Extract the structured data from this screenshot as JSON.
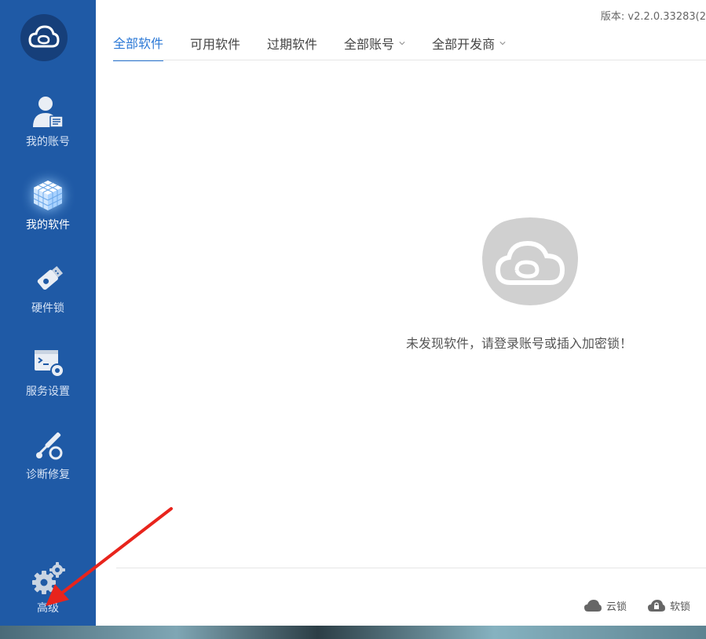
{
  "app": {
    "version": "版本: v2.2.0.33283(2"
  },
  "sidebar": {
    "items": [
      {
        "label": "我的账号",
        "icon": "user-account-icon"
      },
      {
        "label": "我的软件",
        "icon": "software-cube-icon",
        "active": true
      },
      {
        "label": "硬件锁",
        "icon": "usb-dongle-icon"
      },
      {
        "label": "服务设置",
        "icon": "service-terminal-gear-icon"
      },
      {
        "label": "诊断修复",
        "icon": "diagnose-wrench-icon"
      },
      {
        "label": "高级",
        "icon": "gears-icon"
      }
    ]
  },
  "tabs": [
    {
      "label": "全部软件",
      "active": true
    },
    {
      "label": "可用软件"
    },
    {
      "label": "过期软件"
    },
    {
      "label": "全部账号",
      "dropdown": true
    },
    {
      "label": "全部开发商",
      "dropdown": true
    }
  ],
  "main": {
    "empty_message": "未发现软件，请登录账号或插入加密锁！"
  },
  "statusbar": {
    "cloud_lock": "云锁",
    "soft_lock": "软锁"
  },
  "colors": {
    "sidebar": "#1f5aa6",
    "accent": "#2b78d6",
    "annotation_arrow": "#e8241c"
  }
}
